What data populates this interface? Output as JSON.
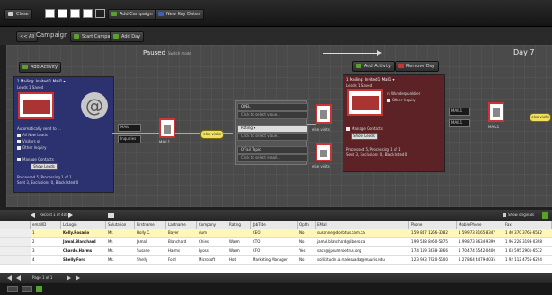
{
  "toolbar": {
    "close_label": "Close",
    "add_campaign_label": "Add Campaign",
    "new_key_dates_label": "New Key Dates",
    "accent_green": "#5aa02c",
    "accent_blue": "#3f5fb8"
  },
  "campaign_bar": {
    "all_button": "<< All",
    "title": "Campaign",
    "start_campaign_label": "Start Campaign",
    "add_day_label": "Add Day"
  },
  "canvas": {
    "paused_label": "Paused",
    "paused_sub": "Switch mode",
    "day_label": "Day 7",
    "add_activity_left": "Add Activity",
    "add_activity_right": "Add Activity",
    "remove_day_label": "Remove Day",
    "left_panel": {
      "title": "1 Mailing: Invited 1 Mail1 ▾",
      "sub": "Leads 1 Saved",
      "items": [
        "Automatically send to ...",
        "All New Leads",
        "Visitors of",
        "Other Inquiry"
      ],
      "check_label": "Manage Contacts",
      "button": "Show Leads",
      "foot1": "Processed 5, Processing 1 of 1",
      "foot2": "Sent 3, Exclusions 0, Blacklisted 0"
    },
    "mid_nodes": {
      "mail_label": "MAIL",
      "mail_label_2": "MAIL1",
      "connector_1": "MAIL",
      "connector_2": "Inquiries",
      "pill_left": "else visits",
      "rules": [
        "OPEL",
        "Click to select value...",
        "Rating",
        "Click to select value...",
        "O'Fail Topic",
        "Click to select email..."
      ],
      "rule_select": "Rating ▾",
      "mail_right_label": "else visits",
      "visit_label": "else visits",
      "mail_right_caption": "MAIL1"
    },
    "right_panel": {
      "title": "1 Mailing: Invited 1 Mail1 ▾",
      "sub": "Leads 1 Saved",
      "check1": "In Wunderpunktier",
      "check2": "Other Inquiry",
      "check_label": "Manage Contacts",
      "button": "Show Leads",
      "foot1": "Processed 5, Processing 1 of 1",
      "foot2": "Sent 3, Exclusions 0, Blacklisted 0"
    },
    "right_nodes": {
      "connector_1": "MAIL1",
      "connector_2": "MAIL1",
      "caption": "MAIL1",
      "pill": "else visits"
    }
  },
  "grid": {
    "record_label": "Record 1 of 405",
    "show_originals_label": "Show originals",
    "columns": [
      "emailID",
      "LdLogin",
      "Salutation",
      "Firstname",
      "Lastname",
      "Company",
      "Rating",
      "JobTitle",
      "OptIn",
      "EMail",
      "Phone",
      "MobilePhone",
      "Fax"
    ],
    "rows": [
      [
        "1",
        "Kelly.Rosario",
        "Mr.",
        "Holly C.",
        "Bayer",
        "dum",
        "",
        "CEO",
        "No",
        "susanne@dorlotus.com.ca",
        "1 59 847 1266-3082",
        "1 59 973 8165-8347",
        "1 40 370 3765-6582"
      ],
      [
        "2",
        "Jamal.Blanchard",
        "Mr.",
        "Jamal",
        "Blanchard",
        "Chiesi",
        "Warm",
        "CTO",
        "No",
        "jamal.blanchard@libero.ca",
        "1 99 548 8460-5875",
        "1 99 873 8634-9399",
        "1 96 228 3193-0398"
      ],
      [
        "3",
        "Chardo.Harms",
        "Ms.",
        "Susane",
        "Harms",
        "Lyoss",
        "Warm",
        "CFO",
        "Yes",
        "sacd@jpsumnoetrus.org",
        "1 74 159 3638-3366",
        "1 70 474 6542-0400",
        "1 63 595 2901-6572"
      ],
      [
        "4",
        "Shelly.Ford",
        "Ms.",
        "Shelly",
        "Ford",
        "Microsoft",
        "Hot",
        "Marketing Manager",
        "No",
        "sollicitudin.a.malesuada@mauris.edu",
        "1 23 993 7920-5500",
        "1 27 864 4479-4035",
        "1 92 112 4755-6294"
      ]
    ],
    "highlight_color": "#fff6b8"
  },
  "pager": {
    "page_label": "Page 1 of 1"
  }
}
